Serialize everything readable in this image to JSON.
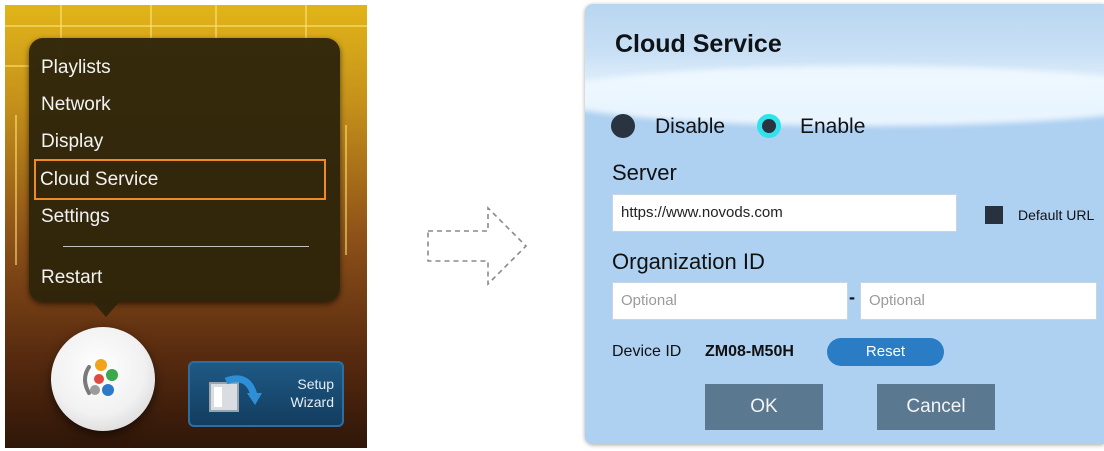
{
  "menu": {
    "items": [
      {
        "label": "Playlists"
      },
      {
        "label": "Network"
      },
      {
        "label": "Display"
      },
      {
        "label": "Cloud Service",
        "selected": true
      },
      {
        "label": "Settings"
      }
    ],
    "restart_label": "Restart"
  },
  "setup_wizard": {
    "label_line1": "Setup",
    "label_line2": "Wizard"
  },
  "dialog": {
    "title": "Cloud Service",
    "radio": {
      "disable_label": "Disable",
      "enable_label": "Enable",
      "selected": "Enable"
    },
    "server": {
      "label": "Server",
      "value": "https://www.novods.com"
    },
    "default_url": {
      "label": "Default URL",
      "checked": true
    },
    "organization": {
      "label": "Organization ID",
      "field1_placeholder": "Optional",
      "separator": "-",
      "field2_placeholder": "Optional"
    },
    "device": {
      "label": "Device ID",
      "value": "ZM08-M50H",
      "reset_label": "Reset"
    },
    "ok_label": "OK",
    "cancel_label": "Cancel"
  },
  "colors": {
    "menu_highlight": "#f08a26",
    "dialog_bg": "#aed0f1",
    "enable_radio": "#2ee3ec",
    "reset_button": "#2a7dc4",
    "action_button": "#5a7890"
  }
}
